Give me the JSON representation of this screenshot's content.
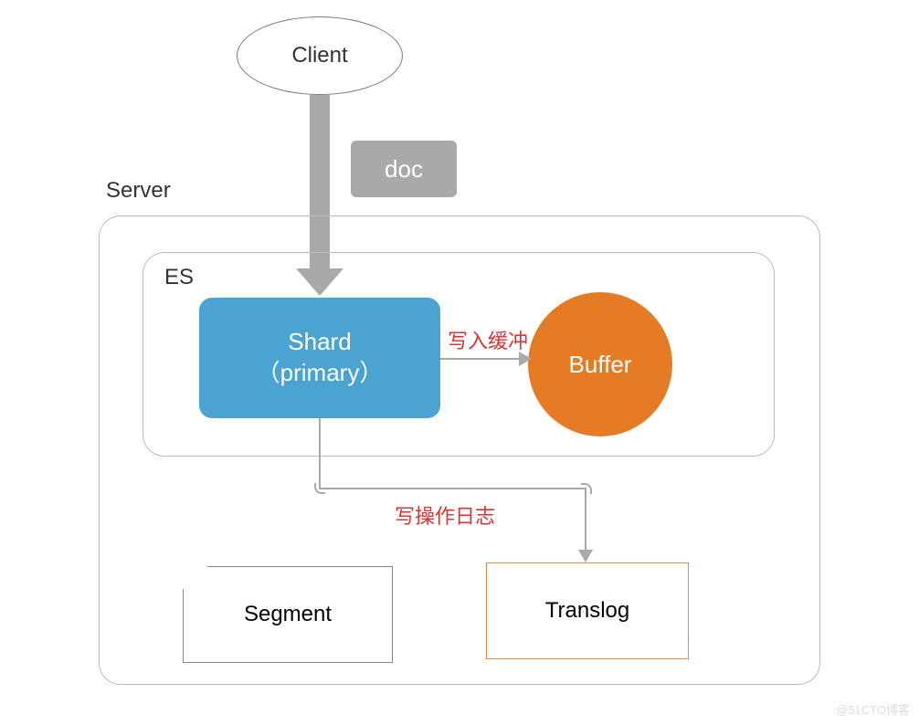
{
  "client": {
    "label": "Client"
  },
  "doc": {
    "label": "doc"
  },
  "server": {
    "label": "Server"
  },
  "es": {
    "label": "ES"
  },
  "shard": {
    "line1": "Shard",
    "line2": "（primary）"
  },
  "buffer": {
    "label": "Buffer"
  },
  "labels": {
    "write_buffer": "写入缓冲",
    "write_log": "写操作日志"
  },
  "segment": {
    "label": "Segment"
  },
  "translog": {
    "label": "Translog"
  },
  "watermark": "@51CTO博客"
}
